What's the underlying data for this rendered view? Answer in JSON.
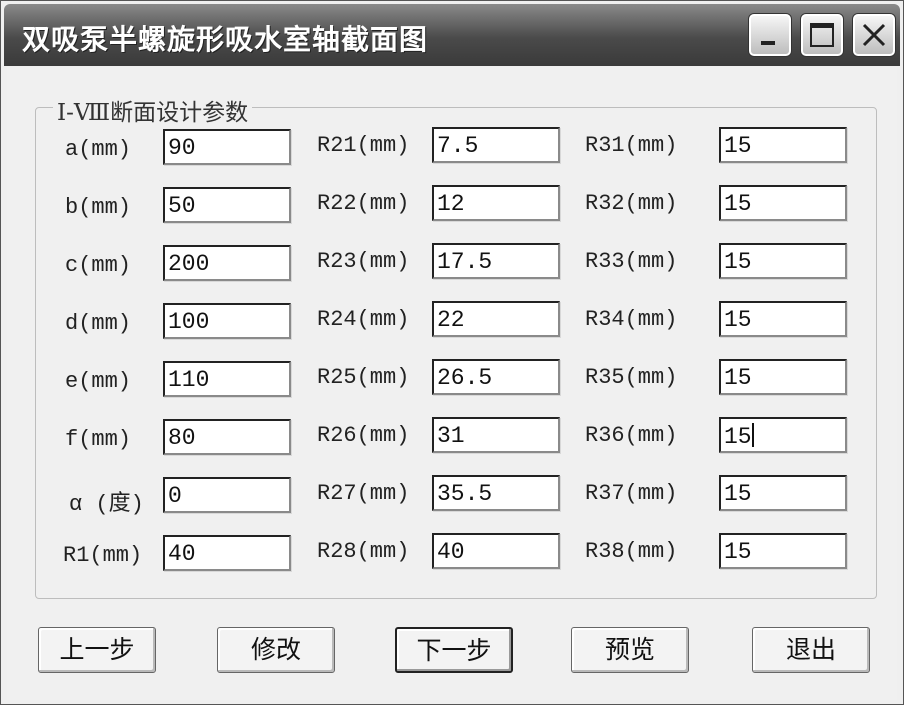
{
  "window": {
    "title": "双吸泵半螺旋形吸水室轴截面图"
  },
  "group": {
    "title": "Ⅰ-Ⅷ断面设计参数"
  },
  "col1": [
    {
      "label": "a(mm)",
      "value": "90"
    },
    {
      "label": "b(mm)",
      "value": "50"
    },
    {
      "label": "c(mm)",
      "value": "200"
    },
    {
      "label": "d(mm)",
      "value": "100"
    },
    {
      "label": "e(mm)",
      "value": "110"
    },
    {
      "label": "f(mm)",
      "value": "80"
    },
    {
      "label": "α (度)",
      "value": "0"
    },
    {
      "label": "R1(mm)",
      "value": "40"
    }
  ],
  "col2": [
    {
      "label": "R21(mm)",
      "value": "7.5"
    },
    {
      "label": "R22(mm)",
      "value": "12"
    },
    {
      "label": "R23(mm)",
      "value": "17.5"
    },
    {
      "label": "R24(mm)",
      "value": "22"
    },
    {
      "label": "R25(mm)",
      "value": "26.5"
    },
    {
      "label": "R26(mm)",
      "value": "31"
    },
    {
      "label": "R27(mm)",
      "value": "35.5"
    },
    {
      "label": "R28(mm)",
      "value": "40"
    }
  ],
  "col3": [
    {
      "label": "R31(mm)",
      "value": "15"
    },
    {
      "label": "R32(mm)",
      "value": "15"
    },
    {
      "label": "R33(mm)",
      "value": "15"
    },
    {
      "label": "R34(mm)",
      "value": "15"
    },
    {
      "label": "R35(mm)",
      "value": "15"
    },
    {
      "label": "R36(mm)",
      "value": "15"
    },
    {
      "label": "R37(mm)",
      "value": "15"
    },
    {
      "label": "R38(mm)",
      "value": "15"
    }
  ],
  "buttons": {
    "prev": "上一步",
    "modify": "修改",
    "next": "下一步",
    "preview": "预览",
    "exit": "退出"
  },
  "icons": [
    "minimize-icon",
    "maximize-icon",
    "close-icon"
  ]
}
